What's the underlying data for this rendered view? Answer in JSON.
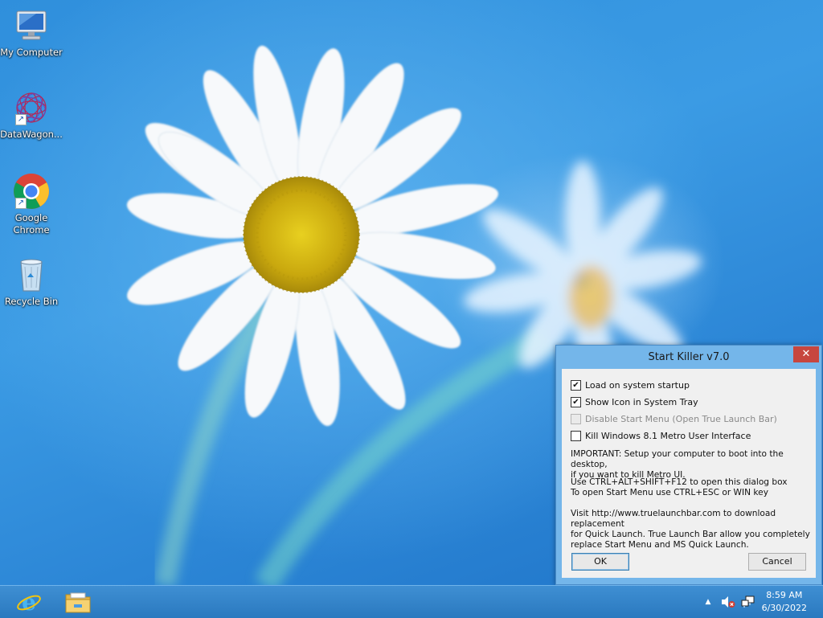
{
  "desktop": {
    "icons": [
      {
        "label": "My Computer",
        "icon": "computer-icon"
      },
      {
        "label": "DataWagon...",
        "icon": "datawagon-icon"
      },
      {
        "label": "Google\nChrome",
        "icon": "chrome-icon"
      },
      {
        "label": "Recycle Bin",
        "icon": "recycle-bin-icon"
      }
    ]
  },
  "dialog": {
    "title": "Start Killer v7.0",
    "close_label": "✕",
    "options": [
      {
        "label": "Load on system startup",
        "checked": true,
        "enabled": true
      },
      {
        "label": "Show Icon in System Tray",
        "checked": true,
        "enabled": true
      },
      {
        "label": "Disable Start Menu (Open True Launch Bar)",
        "checked": false,
        "enabled": false
      },
      {
        "label": "Kill Windows 8.1 Metro User Interface",
        "checked": false,
        "enabled": true
      }
    ],
    "important_text": "IMPORTANT: Setup your computer to boot into the desktop,\nif you want to kill Metro UI.",
    "shortcut_text": "Use CTRL+ALT+SHIFT+F12 to open this dialog box\nTo open Start Menu use CTRL+ESC or WIN key",
    "visit_text": "Visit http://www.truelaunchbar.com to download replacement\nfor Quick Launch. True Launch Bar allow you completely\nreplace Start Menu and MS Quick Launch.",
    "ok_label": "OK",
    "cancel_label": "Cancel"
  },
  "taskbar": {
    "pinned": [
      {
        "name": "Internet Explorer",
        "icon": "internet-explorer-icon"
      },
      {
        "name": "File Explorer",
        "icon": "file-explorer-icon"
      }
    ],
    "tray_icons": [
      "show-hidden-icons-arrow",
      "speaker-muted-icon",
      "network-icon"
    ],
    "time": "8:59 AM",
    "date": "6/30/2022"
  }
}
